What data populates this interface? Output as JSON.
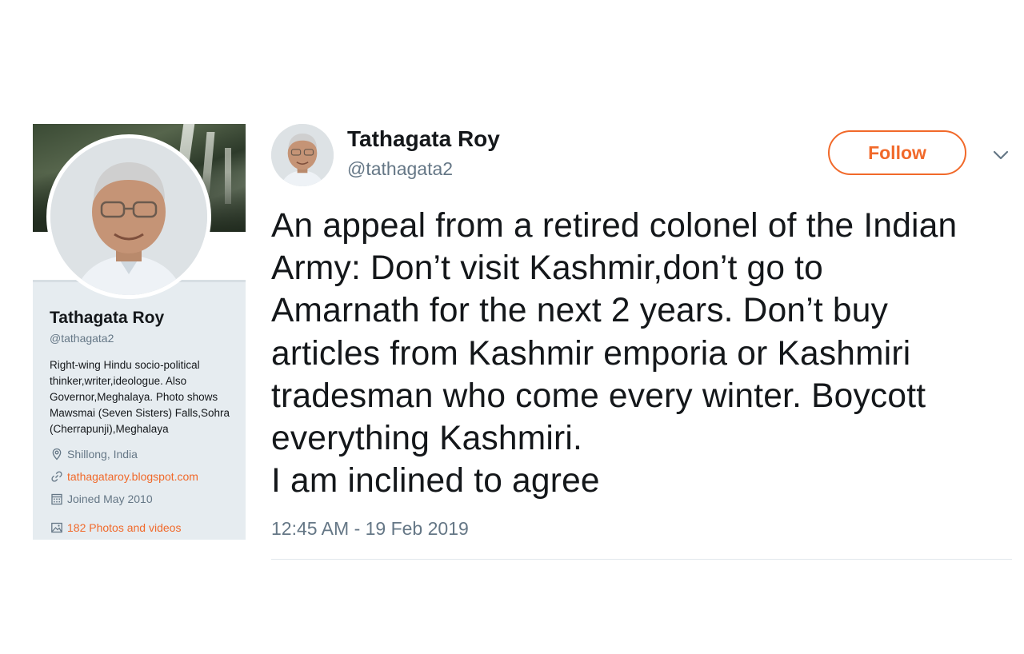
{
  "profile": {
    "name": "Tathagata Roy",
    "handle": "@tathagata2",
    "bio": "Right-wing Hindu socio-political thinker,writer,ideologue. Also Governor,Meghalaya. Photo shows Mawsmai (Seven Sisters) Falls,Sohra (Cherrapunji),Meghalaya",
    "location": "Shillong, India",
    "website": "tathagataroy.blogspot.com",
    "joined": "Joined May 2010",
    "photos": "182 Photos and videos",
    "icons": [
      "location-icon",
      "link-icon",
      "calendar-icon",
      "photos-icon"
    ]
  },
  "tweet": {
    "author_name": "Tathagata Roy",
    "author_handle": "@tathagata2",
    "follow_label": "Follow",
    "text": "An appeal from a retired colonel of the Indian\nArmy: Don’t visit Kashmir,don’t go to\nAmarnath for the next 2 years. Don’t buy\narticles from Kashmir emporia or Kashmiri\ntradesman who come every winter. Boycott\neverything Kashmiri.\nI am inclined to agree",
    "timestamp": "12:45 AM - 19 Feb 2019"
  },
  "colors": {
    "accent": "#f1692a",
    "secondary_text": "#657786",
    "card_background": "#e6ecf0"
  }
}
